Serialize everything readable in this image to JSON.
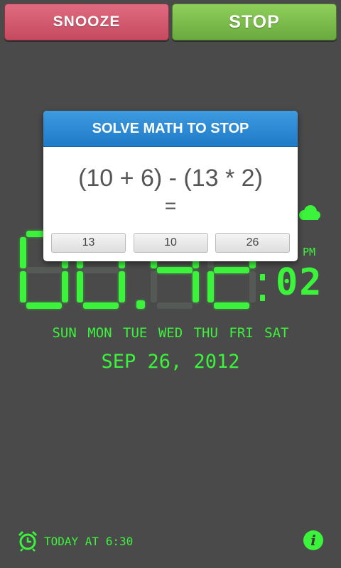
{
  "buttons": {
    "snooze_label": "SNOOZE",
    "stop_label": "STOP"
  },
  "colors": {
    "digit_green": "#3cf33c",
    "background": "#4a4a4a",
    "snooze": "#d65a70",
    "stop": "#7bbd4c",
    "dialog_header": "#2a8ad3"
  },
  "clock": {
    "hours_minutes": "00.42",
    "ampm": "PM",
    "seconds": "02"
  },
  "weekdays": [
    "SUN",
    "MON",
    "TUE",
    "WED",
    "THU",
    "FRI",
    "SAT"
  ],
  "date": "SEP 26, 2012",
  "weather_icon": "cloud-icon",
  "alarm": {
    "icon": "alarm-clock-icon",
    "text": "TODAY AT 6:30"
  },
  "info": {
    "label": "i"
  },
  "dialog": {
    "title": "SOLVE MATH TO STOP",
    "equation": "(10 + 6) - (13 * 2)",
    "equals": "=",
    "answers": [
      "13",
      "10",
      "26"
    ]
  }
}
